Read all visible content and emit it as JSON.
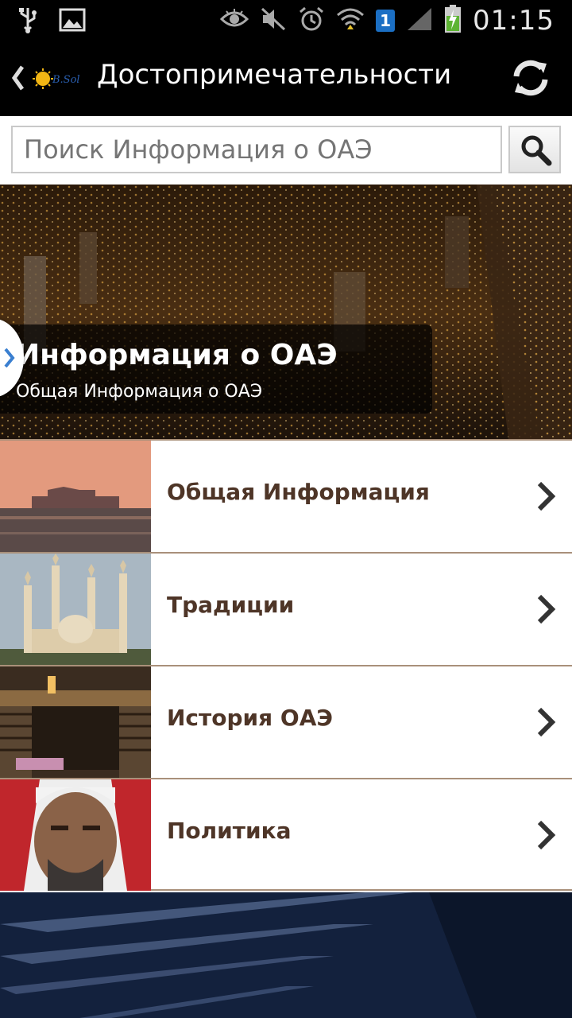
{
  "status_bar": {
    "time": "01:15",
    "sim_badge": "1"
  },
  "action_bar": {
    "title": "Достопримечательности"
  },
  "search": {
    "placeholder": "Поиск Информация о ОАЭ",
    "value": ""
  },
  "banner": {
    "title": "Информация о ОАЭ",
    "subtitle": "Общая Информация о ОАЭ"
  },
  "list": {
    "items": [
      {
        "label": "Общая Информация"
      },
      {
        "label": "Традиции"
      },
      {
        "label": "История ОАЭ"
      },
      {
        "label": "Политика"
      }
    ]
  },
  "colors": {
    "label_text": "#4e3527",
    "divider": "#a9907a"
  }
}
